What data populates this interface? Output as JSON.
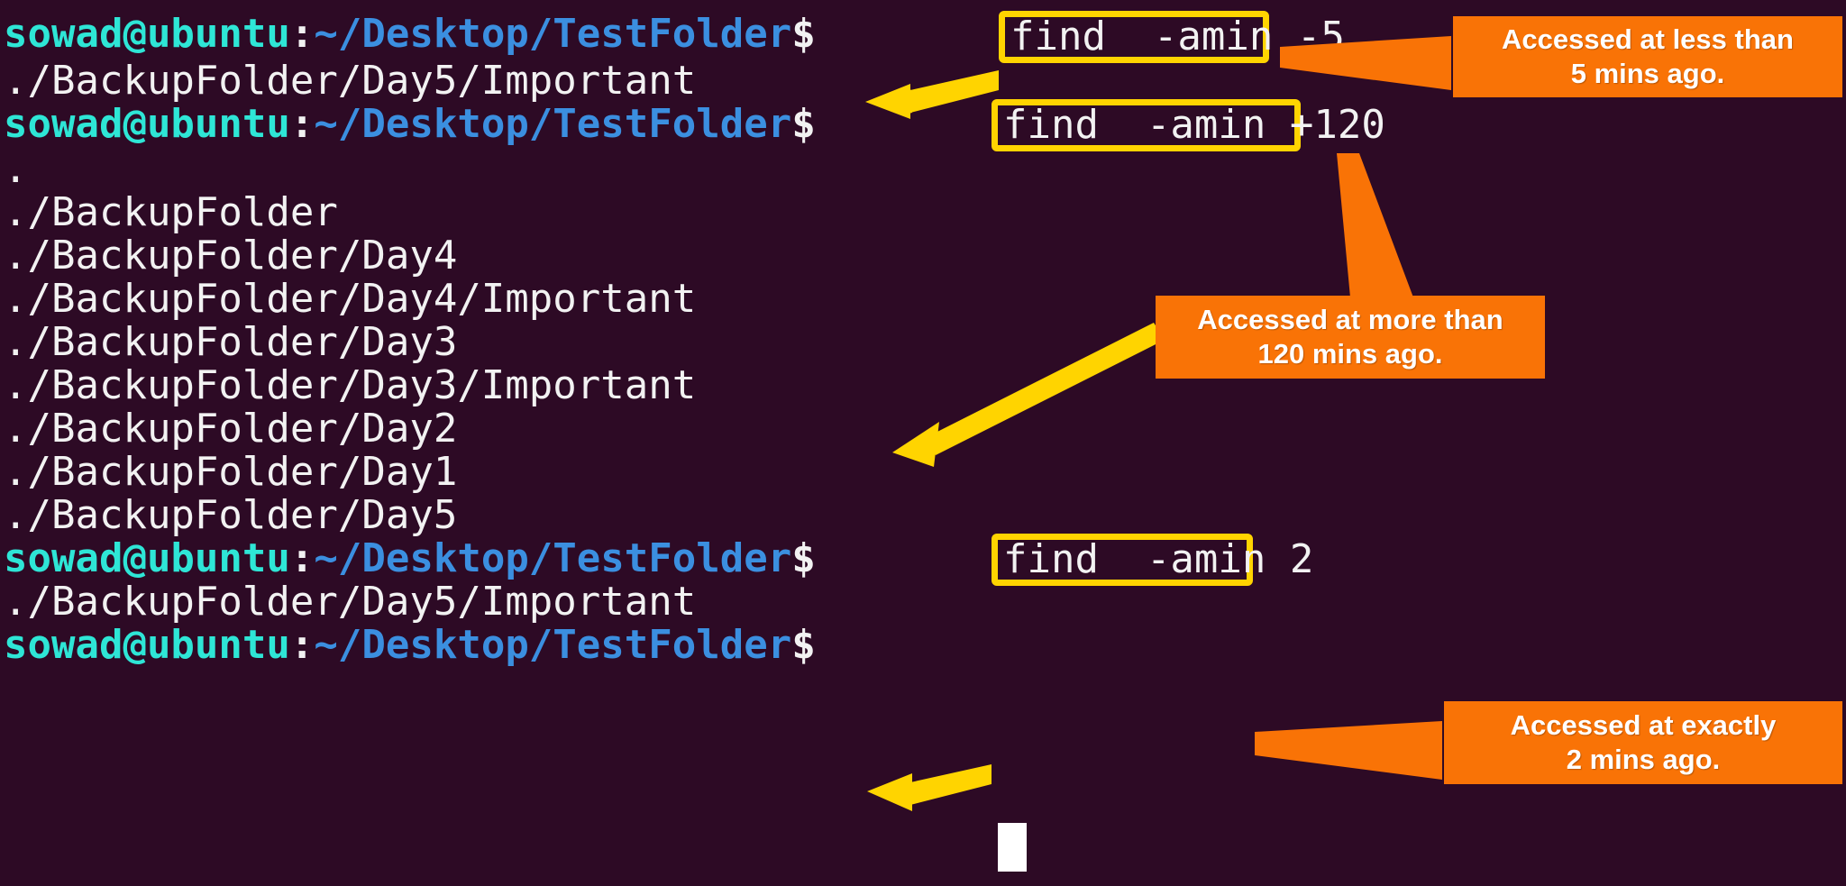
{
  "terminal": {
    "background_color": "#2d0a25",
    "prompt": {
      "user_host": "sowad@ubuntu",
      "colon": ":",
      "path": "~/Desktop/TestFolder",
      "dollar": "$",
      "user_host_color": "#2ee6d6",
      "path_color": "#3b8fe0",
      "text_color": "#f2f2f2"
    },
    "highlight_color": "#ffd400",
    "callout_color": "#f97306",
    "lines": [
      {
        "type": "prompt",
        "command": "find -amin -5"
      },
      {
        "type": "output",
        "text": "./BackupFolder/Day5/Important"
      },
      {
        "type": "prompt",
        "command": "find -amin +120"
      },
      {
        "type": "output",
        "text": "."
      },
      {
        "type": "output",
        "text": "./BackupFolder"
      },
      {
        "type": "output",
        "text": "./BackupFolder/Day4"
      },
      {
        "type": "output",
        "text": "./BackupFolder/Day4/Important"
      },
      {
        "type": "output",
        "text": "./BackupFolder/Day3"
      },
      {
        "type": "output",
        "text": "./BackupFolder/Day3/Important"
      },
      {
        "type": "output",
        "text": "./BackupFolder/Day2"
      },
      {
        "type": "output",
        "text": "./BackupFolder/Day1"
      },
      {
        "type": "output",
        "text": "./BackupFolder/Day5"
      },
      {
        "type": "prompt",
        "command": "find -amin 2"
      },
      {
        "type": "output",
        "text": "./BackupFolder/Day5/Important"
      },
      {
        "type": "prompt",
        "command": ""
      }
    ]
  },
  "commands": {
    "cmd1": "find  -amin -5",
    "cmd2": "find  -amin +120",
    "cmd3": "find  -amin 2"
  },
  "output_lines": {
    "l1": "./BackupFolder/Day5/Important",
    "l2": ".",
    "l3": "./BackupFolder",
    "l4": "./BackupFolder/Day4",
    "l5": "./BackupFolder/Day4/Important",
    "l6": "./BackupFolder/Day3",
    "l7": "./BackupFolder/Day3/Important",
    "l8": "./BackupFolder/Day2",
    "l9": "./BackupFolder/Day1",
    "l10": "./BackupFolder/Day5",
    "l11": "./BackupFolder/Day5/Important"
  },
  "callouts": [
    {
      "line1": "Accessed at less than",
      "line2": "5 mins ago."
    },
    {
      "line1": "Accessed at more than",
      "line2": "120 mins ago."
    },
    {
      "line1": "Accessed at exactly",
      "line2": "2 mins ago."
    }
  ]
}
